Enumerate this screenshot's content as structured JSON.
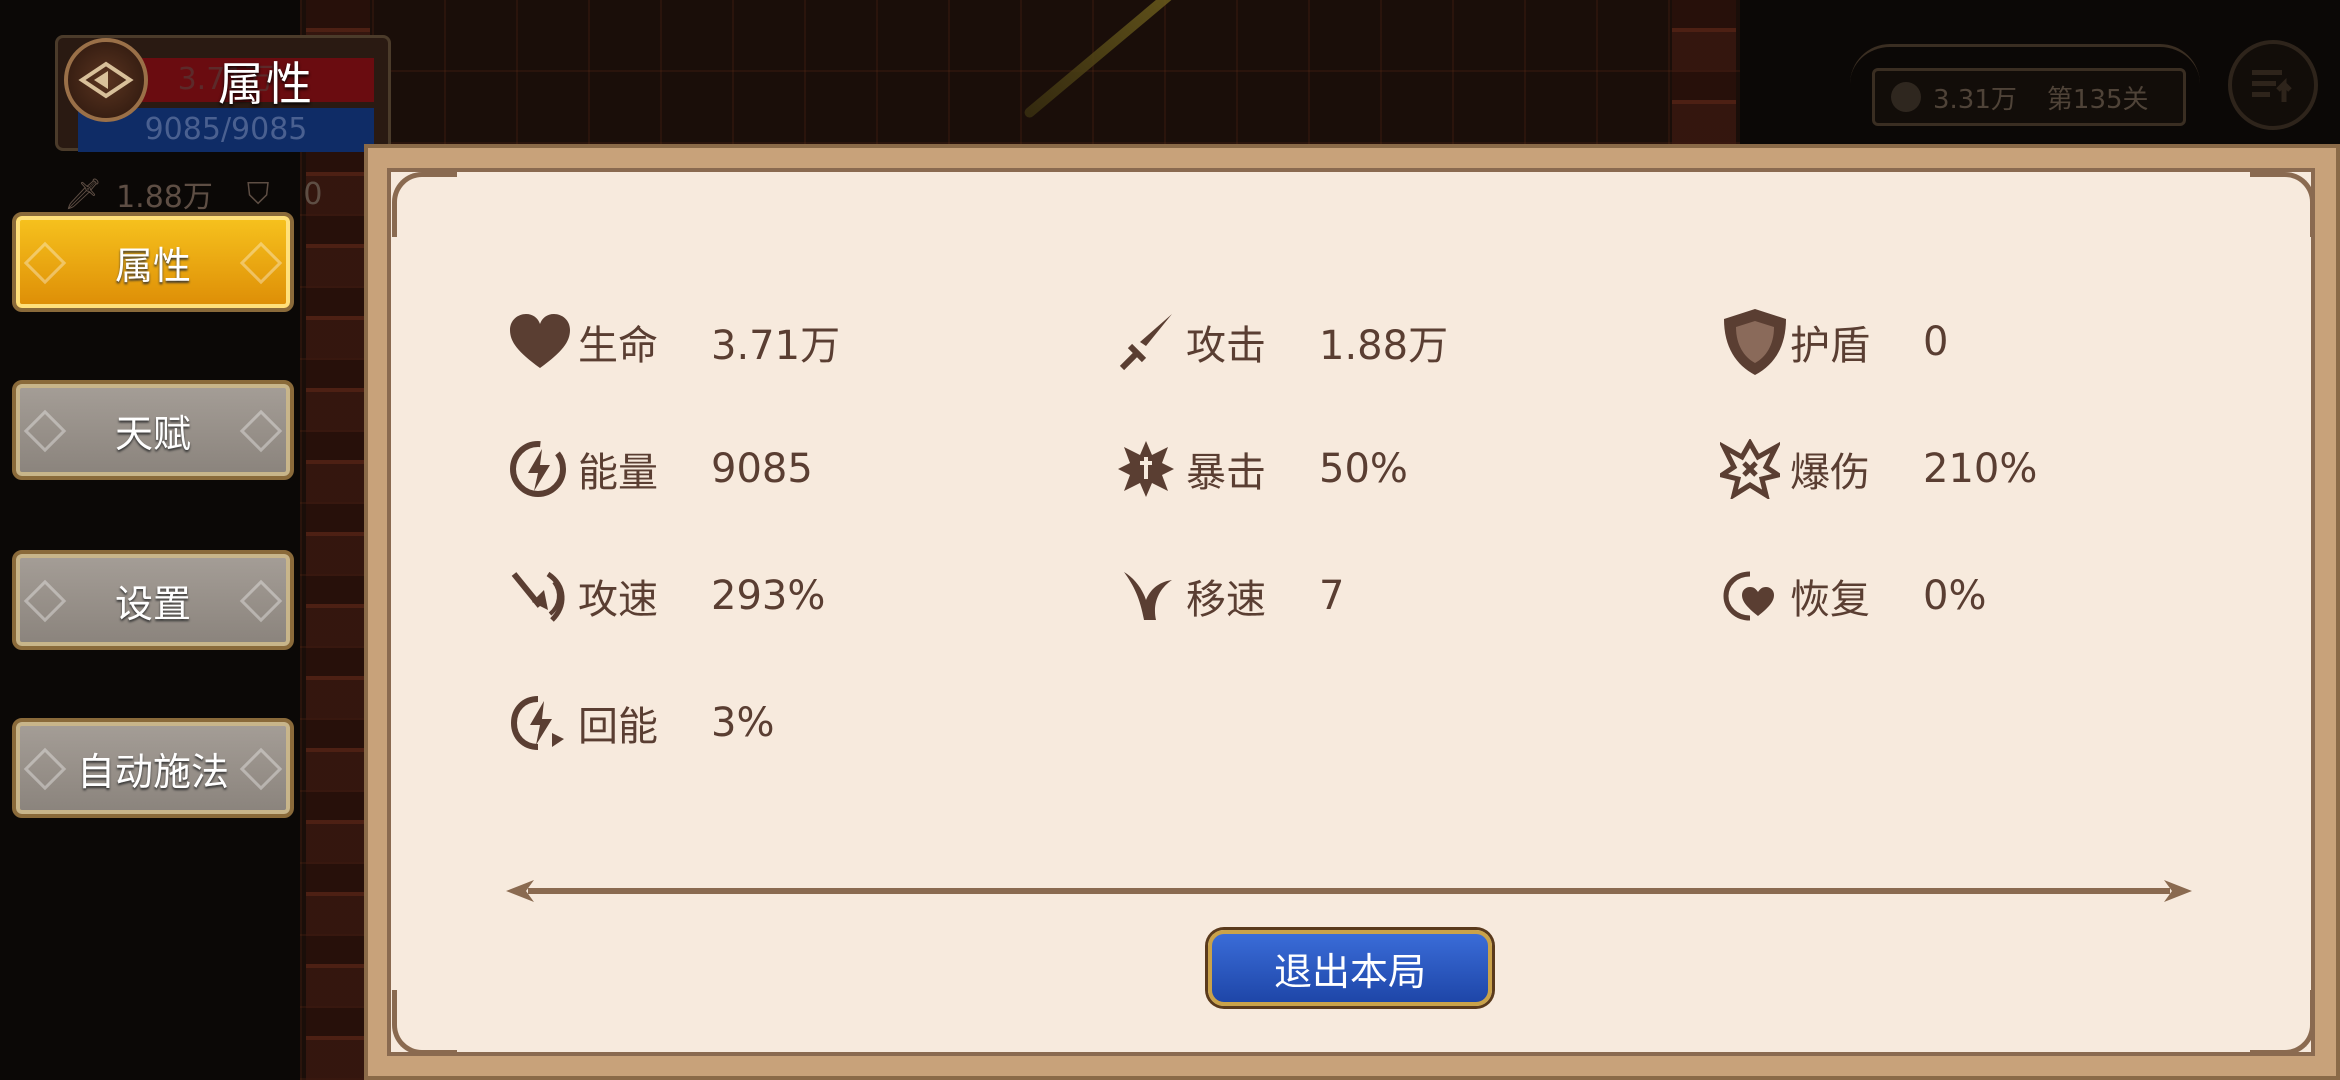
{
  "hud": {
    "title": "属性",
    "hp_text": "3.71万",
    "energy_text": "9085/9085",
    "attack_value": "1.88万",
    "shield_value": "0"
  },
  "tabs": [
    {
      "label": "属性",
      "active": true
    },
    {
      "label": "天赋",
      "active": false
    },
    {
      "label": "设置",
      "active": false
    },
    {
      "label": "自动施法",
      "active": false
    }
  ],
  "top_right": {
    "coins": "3.31万",
    "stage": "第135关"
  },
  "stats": {
    "hp": {
      "label": "生命",
      "value": "3.71万",
      "icon": "heart-icon"
    },
    "attack": {
      "label": "攻击",
      "value": "1.88万",
      "icon": "sword-icon"
    },
    "shield": {
      "label": "护盾",
      "value": "0",
      "icon": "shield-icon"
    },
    "energy": {
      "label": "能量",
      "value": "9085",
      "icon": "lightning-icon"
    },
    "crit": {
      "label": "暴击",
      "value": "50%",
      "icon": "crit-icon"
    },
    "crit_damage": {
      "label": "爆伤",
      "value": "210%",
      "icon": "crit-damage-icon"
    },
    "attack_speed": {
      "label": "攻速",
      "value": "293%",
      "icon": "attack-speed-icon"
    },
    "move_speed": {
      "label": "移速",
      "value": "7",
      "icon": "wing-icon"
    },
    "regen": {
      "label": "恢复",
      "value": "0%",
      "icon": "heart-regen-icon"
    },
    "energy_regen": {
      "label": "回能",
      "value": "3%",
      "icon": "energy-regen-icon"
    }
  },
  "quit_button": "退出本局",
  "colors": {
    "panel_bg": "#f7eadd",
    "text_brown": "#5a3e32",
    "active_tab": "#f0a712",
    "inactive_tab": "#9a938c",
    "quit_button": "#2a58c4"
  }
}
